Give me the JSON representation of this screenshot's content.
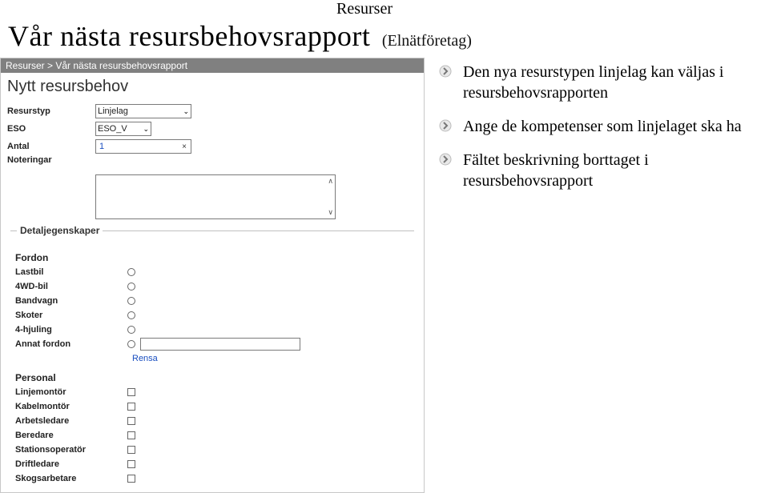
{
  "header": {
    "top_label": "Resurser",
    "title": "Vår nästa resursbehovsrapport",
    "subtitle": "(Elnätföretag)"
  },
  "screenshot": {
    "breadcrumb": "Resurser > Vår nästa resursbehovsrapport",
    "heading": "Nytt resursbehov",
    "fields": {
      "resurstyp": {
        "label": "Resurstyp",
        "value": "Linjelag"
      },
      "eso": {
        "label": "ESO",
        "value": "ESO_V"
      },
      "antal": {
        "label": "Antal",
        "value": "1"
      },
      "noteringar": {
        "label": "Noteringar"
      },
      "detaljegenskaper": {
        "legend": "Detaljegenskaper"
      }
    },
    "fordon": {
      "heading": "Fordon",
      "items": [
        "Lastbil",
        "4WD-bil",
        "Bandvagn",
        "Skoter",
        "4-hjuling"
      ],
      "annat": "Annat fordon",
      "rensa": "Rensa"
    },
    "personal": {
      "heading": "Personal",
      "items": [
        "Linjemontör",
        "Kabelmontör",
        "Arbetsledare",
        "Beredare",
        "Stationsoperatör",
        "Driftledare",
        "Skogsarbetare"
      ]
    }
  },
  "bullets": {
    "b1": "Den nya resurstypen linjelag kan väljas i resursbehovsrapporten",
    "b2": "Ange de kompetenser som linjelaget ska ha",
    "b3": "Fältet beskrivning borttaget i resursbehovsrapport"
  }
}
